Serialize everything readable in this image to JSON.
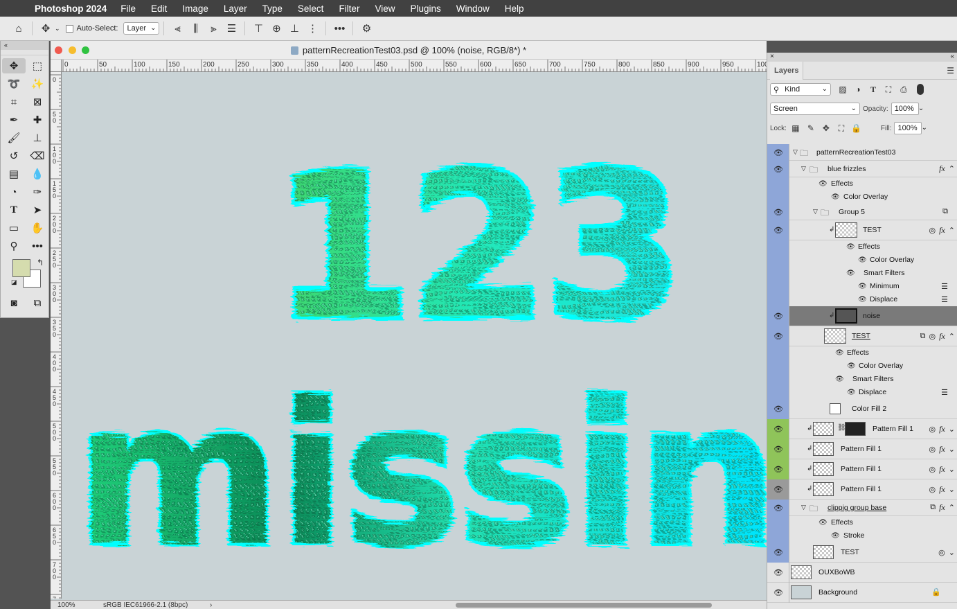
{
  "menubar": {
    "app": "Photoshop 2024",
    "items": [
      "File",
      "Edit",
      "Image",
      "Layer",
      "Type",
      "Select",
      "Filter",
      "View",
      "Plugins",
      "Window",
      "Help"
    ]
  },
  "options": {
    "auto_select_label": "Auto-Select:",
    "auto_select_value": "Layer"
  },
  "document": {
    "title": "patternRecreationTest03.psd @ 100% (noise, RGB/8*) *",
    "zoom": "100%",
    "profile": "sRGB IEC61966-2.1 (8bpc)",
    "artwork_text": [
      "123",
      "missin"
    ]
  },
  "rulers": {
    "h_ticks": [
      "0",
      "50",
      "100",
      "150",
      "200",
      "250",
      "300",
      "350",
      "400",
      "450",
      "500",
      "550",
      "600",
      "650",
      "700",
      "750",
      "800",
      "850",
      "900",
      "950",
      "100"
    ],
    "v_ticks": [
      "0",
      "50",
      "100",
      "150",
      "200",
      "250",
      "300",
      "350",
      "400",
      "450",
      "500",
      "550",
      "600",
      "650",
      "700",
      "7"
    ]
  },
  "colors": {
    "foreground": "#d5dcae",
    "background": "#ffffff",
    "selected_row": "#7a7a7a",
    "group_eye": "#8ea6d8",
    "fill_eye": "#8fc45a",
    "gray_eye": "#9a9a9a"
  },
  "layers_panel": {
    "tab": "Layers",
    "filter_kind": "Kind",
    "blend_mode": "Screen",
    "opacity_label": "Opacity:",
    "opacity_value": "100%",
    "lock_label": "Lock:",
    "fill_label": "Fill:",
    "fill_value": "100%",
    "rows": [
      {
        "label": "patternRecreationTest03",
        "type": "group",
        "eye": true
      },
      {
        "label": "blue frizzles",
        "type": "group",
        "eye": true,
        "fx": true
      },
      {
        "label": "Effects",
        "type": "sub"
      },
      {
        "label": "Color Overlay",
        "type": "sub"
      },
      {
        "label": "Group 5",
        "type": "group",
        "eye": true
      },
      {
        "label": "TEST",
        "type": "smart",
        "eye": true,
        "fx": true
      },
      {
        "label": "Effects",
        "type": "sub"
      },
      {
        "label": "Color Overlay",
        "type": "sub"
      },
      {
        "label": "Smart Filters",
        "type": "sub"
      },
      {
        "label": "Minimum",
        "type": "sub"
      },
      {
        "label": "Displace",
        "type": "sub"
      },
      {
        "label": "noise",
        "type": "smart",
        "eye": true,
        "selected": true
      },
      {
        "label": "TEST",
        "type": "smart",
        "eye": true,
        "fx": true
      },
      {
        "label": "Effects",
        "type": "sub"
      },
      {
        "label": "Color Overlay",
        "type": "sub"
      },
      {
        "label": "Smart Filters",
        "type": "sub"
      },
      {
        "label": "Displace",
        "type": "sub"
      },
      {
        "label": "Color Fill 2",
        "type": "fill",
        "eye": true
      },
      {
        "label": "Pattern Fill 1",
        "type": "pattern",
        "eye": true,
        "fx": true
      },
      {
        "label": "Pattern Fill 1",
        "type": "pattern",
        "eye": true,
        "fx": true
      },
      {
        "label": "Pattern Fill 1",
        "type": "pattern",
        "eye": true,
        "fx": true
      },
      {
        "label": "Pattern Fill 1",
        "type": "pattern",
        "eye": true,
        "fx": true
      },
      {
        "label": "clippig group base",
        "type": "group",
        "eye": true,
        "fx": true
      },
      {
        "label": "Effects",
        "type": "sub"
      },
      {
        "label": "Stroke",
        "type": "sub"
      },
      {
        "label": "TEST",
        "type": "smart",
        "eye": true
      },
      {
        "label": "OUXBoWB",
        "type": "smart",
        "eye": true
      },
      {
        "label": "Background",
        "type": "bg",
        "eye": true
      }
    ]
  }
}
